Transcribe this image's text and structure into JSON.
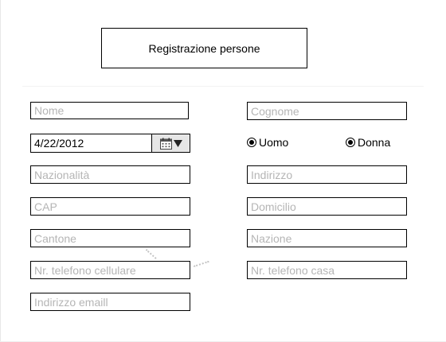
{
  "form": {
    "title": "Registrazione persone",
    "fields": {
      "nome": "Nome",
      "cognome": "Cognome",
      "nazionalita": "Nazionalità",
      "indirizzo": "Indirizzo",
      "cap": "CAP",
      "domicilio": "Domicilio",
      "cantone": "Cantone",
      "nazione": "Nazione",
      "cellulare": "Nr. telefono cellulare",
      "telefono_casa": "Nr. telefono casa",
      "email": "Indirizzo emaill"
    },
    "birth_date": {
      "value": "4/22/2012",
      "button_icon": "calendar-icon",
      "arrow_icon": "triangle-down-icon"
    },
    "gender": {
      "options": [
        "Uomo",
        "Donna"
      ],
      "selected": [
        "Uomo",
        "Donna"
      ]
    }
  }
}
